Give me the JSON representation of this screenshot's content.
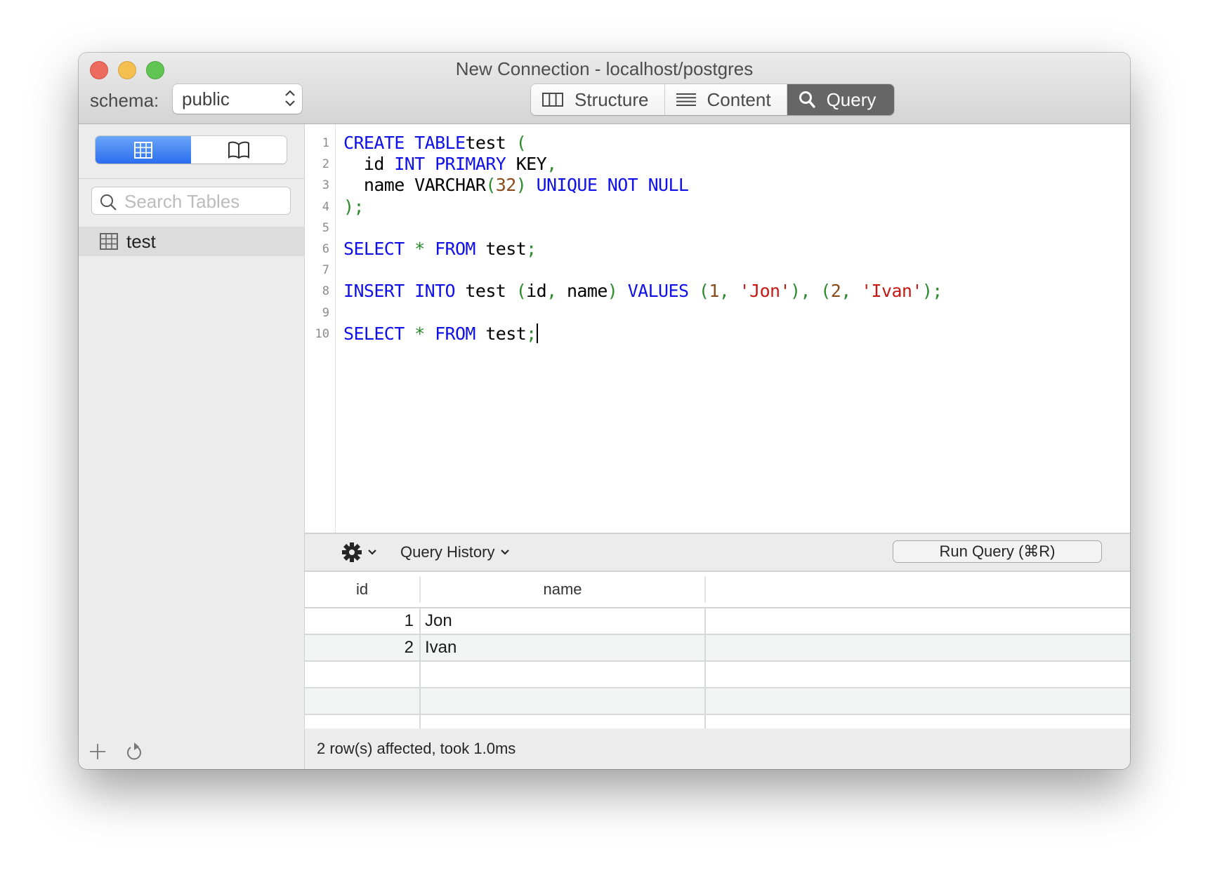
{
  "window": {
    "title": "New Connection - localhost/postgres",
    "traffic_lights": [
      "close",
      "minimize",
      "maximize"
    ]
  },
  "toolbar": {
    "schema_label": "schema:",
    "schema_value": "public",
    "tabs": [
      {
        "label": "Structure",
        "icon": "columns-icon",
        "active": false
      },
      {
        "label": "Content",
        "icon": "list-lines-icon",
        "active": false
      },
      {
        "label": "Query",
        "icon": "search-icon",
        "active": true
      }
    ]
  },
  "sidebar": {
    "view_toggle": [
      {
        "icon": "table-grid-icon",
        "active": true
      },
      {
        "icon": "book-icon",
        "active": false
      }
    ],
    "search_placeholder": "Search Tables",
    "tables": [
      {
        "name": "test",
        "selected": true
      }
    ],
    "bottom_actions": [
      "add-icon",
      "refresh-icon"
    ]
  },
  "editor": {
    "lines": [
      {
        "n": "1",
        "tokens": [
          [
            "kw",
            "CREATE"
          ],
          [
            "",
            "  "
          ],
          [
            "kw",
            "TABLE"
          ],
          [
            "",
            ""
          ],
          [
            "",
            "test "
          ],
          [
            "pn",
            "("
          ]
        ]
      },
      {
        "n": "2",
        "tokens": [
          [
            "",
            "  id "
          ],
          [
            "kw",
            "INT"
          ],
          [
            "",
            " "
          ],
          [
            "kw",
            "PRIMARY"
          ],
          [
            "",
            " KEY"
          ],
          [
            "pn",
            ","
          ]
        ]
      },
      {
        "n": "3",
        "tokens": [
          [
            "",
            "  name VARCHAR"
          ],
          [
            "pn",
            "("
          ],
          [
            "nm",
            "32"
          ],
          [
            "pn",
            ")"
          ],
          [
            "",
            " "
          ],
          [
            "kw",
            "UNIQUE"
          ],
          [
            "",
            " "
          ],
          [
            "kw",
            "NOT"
          ],
          [
            "",
            " "
          ],
          [
            "kw",
            "NULL"
          ]
        ]
      },
      {
        "n": "4",
        "tokens": [
          [
            "pn",
            ");"
          ]
        ]
      },
      {
        "n": "5",
        "tokens": []
      },
      {
        "n": "6",
        "tokens": [
          [
            "kw",
            "SELECT"
          ],
          [
            "",
            " "
          ],
          [
            "pn",
            "*"
          ],
          [
            "",
            " "
          ],
          [
            "kw",
            "FROM"
          ],
          [
            "",
            " test"
          ],
          [
            "pn",
            ";"
          ]
        ]
      },
      {
        "n": "7",
        "tokens": []
      },
      {
        "n": "8",
        "tokens": [
          [
            "kw",
            "INSERT"
          ],
          [
            "",
            " "
          ],
          [
            "kw",
            "INTO"
          ],
          [
            "",
            " test "
          ],
          [
            "pn",
            "("
          ],
          [
            "",
            "id"
          ],
          [
            "pn",
            ","
          ],
          [
            "",
            " name"
          ],
          [
            "pn",
            ")"
          ],
          [
            "",
            " "
          ],
          [
            "kw",
            "VALUES"
          ],
          [
            "",
            " "
          ],
          [
            "pn",
            "("
          ],
          [
            "nm",
            "1"
          ],
          [
            "pn",
            ","
          ],
          [
            "",
            " "
          ],
          [
            "st",
            "'Jon'"
          ],
          [
            "pn",
            "),"
          ],
          [
            "",
            " "
          ],
          [
            "pn",
            "("
          ],
          [
            "nm",
            "2"
          ],
          [
            "pn",
            ","
          ],
          [
            "",
            " "
          ],
          [
            "st",
            "'Ivan'"
          ],
          [
            "pn",
            ");"
          ]
        ]
      },
      {
        "n": "9",
        "tokens": []
      },
      {
        "n": "10",
        "tokens": [
          [
            "kw",
            "SELECT"
          ],
          [
            "",
            " "
          ],
          [
            "pn",
            "*"
          ],
          [
            "",
            " "
          ],
          [
            "kw",
            "FROM"
          ],
          [
            "",
            " test"
          ],
          [
            "pn",
            ";"
          ]
        ],
        "caret": true
      }
    ],
    "syntax_colors": {
      "keyword": "#1010e8",
      "punctuation": "#2b8a2b",
      "number": "#8a4a1a",
      "string": "#c41a16"
    }
  },
  "query_bar": {
    "gear_menu_icon": "gear-icon",
    "history_label": "Query History",
    "run_label": "Run Query (⌘R)"
  },
  "results": {
    "columns": [
      "id",
      "name"
    ],
    "rows": [
      {
        "id": "1",
        "name": "Jon"
      },
      {
        "id": "2",
        "name": "Ivan"
      }
    ],
    "empty_rows": 3
  },
  "status": {
    "text": "2 row(s) affected, took 1.0ms"
  }
}
